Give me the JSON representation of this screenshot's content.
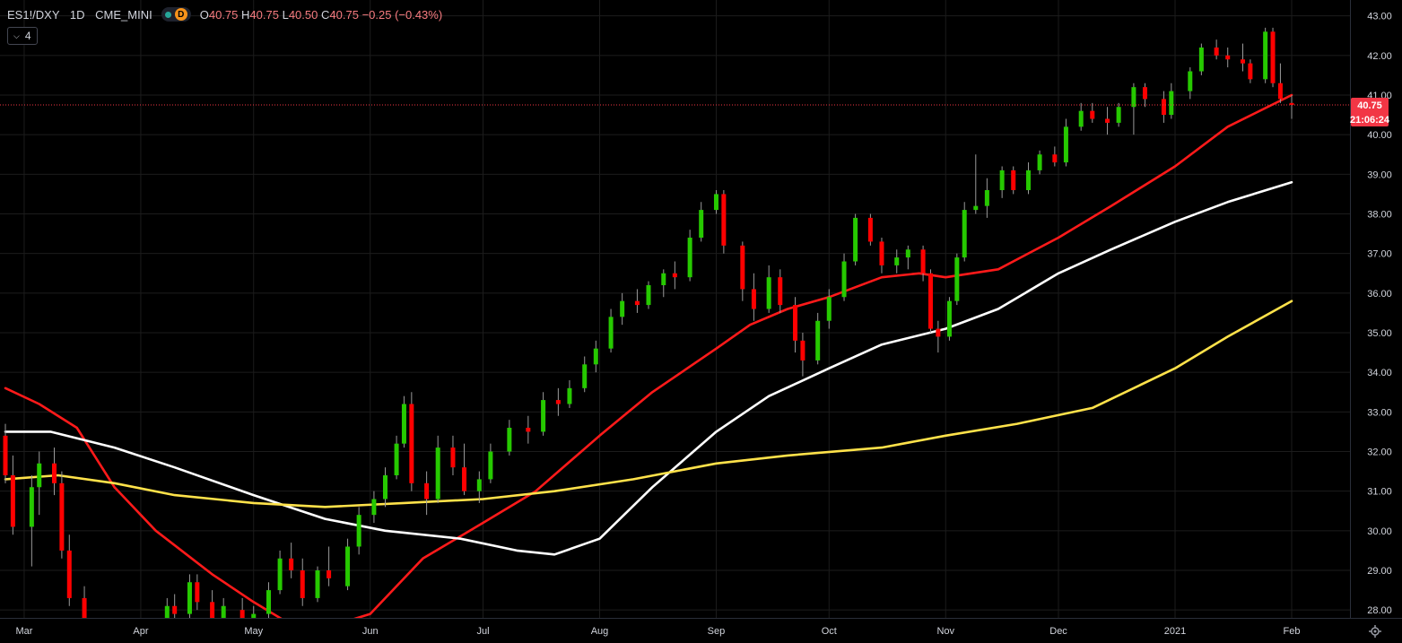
{
  "legend": {
    "symbol": "ES1!/DXY",
    "interval": "1D",
    "exchange": "CME_MINI",
    "status_letter": "D",
    "o_label": "O",
    "o_value": "40.75",
    "h_label": "H",
    "h_value": "40.75",
    "l_label": "L",
    "l_value": "40.50",
    "c_label": "C",
    "c_value": "40.75",
    "change": "−0.25 (−0.43%)",
    "indicators_count": "4"
  },
  "price_tag": {
    "value": "40.75",
    "countdown": "21:06:24"
  },
  "colors": {
    "up": "#26c900",
    "down": "#ff0000",
    "neutral": "#3fd7ea",
    "ma_red": "#ff1a1a",
    "ma_white": "#ffffff",
    "ma_yellow": "#ffe24a",
    "grid": "#1c1c1c",
    "tag": "#f23645"
  },
  "chart_data": {
    "type": "candlestick",
    "ylim": [
      27.8,
      43.4
    ],
    "y_ticks": [
      "28.00",
      "29.00",
      "30.00",
      "31.00",
      "32.00",
      "33.00",
      "34.00",
      "35.00",
      "36.00",
      "37.00",
      "38.00",
      "39.00",
      "40.00",
      "41.00",
      "42.00",
      "43.00"
    ],
    "x_labels": [
      "Mar",
      "Apr",
      "May",
      "Jun",
      "Jul",
      "Aug",
      "Sep",
      "Oct",
      "Nov",
      "Dec",
      "2021",
      "Feb"
    ],
    "x_label_dates": [
      "2020-03-01",
      "2020-04-01",
      "2020-05-01",
      "2020-06-01",
      "2020-07-01",
      "2020-08-01",
      "2020-09-01",
      "2020-10-01",
      "2020-11-01",
      "2020-12-01",
      "2021-01-01",
      "2021-02-01"
    ],
    "date_range": [
      "2020-02-25",
      "2021-02-01"
    ],
    "last_price": 40.75,
    "candles": [
      [
        "2020-02-25",
        32.4,
        32.7,
        31.2,
        31.4
      ],
      [
        "2020-02-27",
        31.4,
        31.9,
        29.9,
        30.1
      ],
      [
        "2020-03-03",
        30.1,
        31.4,
        29.1,
        31.1
      ],
      [
        "2020-03-05",
        31.1,
        32.0,
        30.4,
        31.7
      ],
      [
        "2020-03-09",
        31.7,
        32.1,
        30.9,
        31.2
      ],
      [
        "2020-03-11",
        31.2,
        31.5,
        29.3,
        29.5
      ],
      [
        "2020-03-13",
        29.5,
        29.9,
        28.1,
        28.3
      ],
      [
        "2020-03-17",
        28.3,
        28.6,
        27.3,
        27.5
      ],
      [
        "2020-04-08",
        27.6,
        28.3,
        27.5,
        28.1
      ],
      [
        "2020-04-10",
        28.1,
        28.4,
        27.7,
        27.9
      ],
      [
        "2020-04-14",
        27.9,
        28.9,
        27.8,
        28.7
      ],
      [
        "2020-04-16",
        28.7,
        28.9,
        28.0,
        28.2
      ],
      [
        "2020-04-20",
        28.2,
        28.5,
        27.6,
        27.8
      ],
      [
        "2020-04-23",
        27.8,
        28.3,
        27.5,
        28.1
      ],
      [
        "2020-04-28",
        28.0,
        28.3,
        27.4,
        27.6
      ],
      [
        "2020-05-01",
        27.6,
        28.1,
        27.4,
        27.9
      ],
      [
        "2020-05-05",
        27.9,
        28.7,
        27.8,
        28.5
      ],
      [
        "2020-05-08",
        28.5,
        29.5,
        28.4,
        29.3
      ],
      [
        "2020-05-11",
        29.3,
        29.7,
        28.8,
        29.0
      ],
      [
        "2020-05-14",
        29.0,
        29.3,
        28.1,
        28.3
      ],
      [
        "2020-05-18",
        28.3,
        29.1,
        28.2,
        29.0
      ],
      [
        "2020-05-21",
        29.0,
        29.6,
        28.6,
        28.8
      ],
      [
        "2020-05-26",
        28.6,
        29.8,
        28.5,
        29.6
      ],
      [
        "2020-05-29",
        29.6,
        30.6,
        29.4,
        30.4
      ],
      [
        "2020-06-02",
        30.4,
        31.0,
        30.2,
        30.8
      ],
      [
        "2020-06-05",
        30.8,
        31.6,
        30.6,
        31.4
      ],
      [
        "2020-06-08",
        31.4,
        32.4,
        31.3,
        32.2
      ],
      [
        "2020-06-10",
        32.2,
        33.4,
        32.1,
        33.2
      ],
      [
        "2020-06-12",
        33.2,
        33.5,
        31.0,
        31.2
      ],
      [
        "2020-06-16",
        31.2,
        31.5,
        30.4,
        30.8
      ],
      [
        "2020-06-19",
        30.8,
        32.4,
        30.7,
        32.1
      ],
      [
        "2020-06-23",
        32.1,
        32.4,
        31.4,
        31.6
      ],
      [
        "2020-06-26",
        31.6,
        32.2,
        30.9,
        31.0
      ],
      [
        "2020-06-30",
        31.0,
        31.5,
        30.7,
        31.3
      ],
      [
        "2020-07-03",
        31.3,
        32.2,
        31.2,
        32.0
      ],
      [
        "2020-07-08",
        32.0,
        32.8,
        31.9,
        32.6
      ],
      [
        "2020-07-13",
        32.6,
        32.9,
        32.2,
        32.5
      ],
      [
        "2020-07-17",
        32.5,
        33.5,
        32.4,
        33.3
      ],
      [
        "2020-07-21",
        33.3,
        33.6,
        32.9,
        33.2
      ],
      [
        "2020-07-24",
        33.2,
        33.8,
        33.1,
        33.6
      ],
      [
        "2020-07-28",
        33.6,
        34.4,
        33.5,
        34.2
      ],
      [
        "2020-07-31",
        34.2,
        34.8,
        34.0,
        34.6
      ],
      [
        "2020-08-04",
        34.6,
        35.6,
        34.5,
        35.4
      ],
      [
        "2020-08-07",
        35.4,
        36.0,
        35.2,
        35.8
      ],
      [
        "2020-08-11",
        35.8,
        36.1,
        35.5,
        35.7
      ],
      [
        "2020-08-14",
        35.7,
        36.3,
        35.6,
        36.2
      ],
      [
        "2020-08-18",
        36.2,
        36.6,
        35.9,
        36.5
      ],
      [
        "2020-08-21",
        36.5,
        36.8,
        36.1,
        36.4
      ],
      [
        "2020-08-25",
        36.4,
        37.6,
        36.3,
        37.4
      ],
      [
        "2020-08-28",
        37.4,
        38.3,
        37.3,
        38.1
      ],
      [
        "2020-09-01",
        38.1,
        38.6,
        38.0,
        38.5
      ],
      [
        "2020-09-03",
        38.5,
        38.6,
        37.0,
        37.2
      ],
      [
        "2020-09-08",
        37.2,
        37.3,
        35.8,
        36.1
      ],
      [
        "2020-09-11",
        36.1,
        36.5,
        35.3,
        35.6
      ],
      [
        "2020-09-15",
        35.6,
        36.7,
        35.5,
        36.4
      ],
      [
        "2020-09-18",
        36.4,
        36.6,
        35.5,
        35.7
      ],
      [
        "2020-09-22",
        35.7,
        35.9,
        34.5,
        34.8
      ],
      [
        "2020-09-24",
        34.8,
        35.0,
        33.9,
        34.3
      ],
      [
        "2020-09-28",
        34.3,
        35.5,
        34.2,
        35.3
      ],
      [
        "2020-10-01",
        35.3,
        36.1,
        35.1,
        35.9
      ],
      [
        "2020-10-05",
        35.9,
        37.0,
        35.8,
        36.8
      ],
      [
        "2020-10-08",
        36.8,
        38.0,
        36.7,
        37.9
      ],
      [
        "2020-10-12",
        37.9,
        38.0,
        37.2,
        37.3
      ],
      [
        "2020-10-15",
        37.3,
        37.4,
        36.5,
        36.7
      ],
      [
        "2020-10-19",
        36.7,
        37.1,
        36.5,
        36.9
      ],
      [
        "2020-10-22",
        36.9,
        37.2,
        36.6,
        37.1
      ],
      [
        "2020-10-26",
        37.1,
        37.2,
        36.3,
        36.5
      ],
      [
        "2020-10-28",
        36.5,
        36.6,
        35.0,
        35.1
      ],
      [
        "2020-10-30",
        35.1,
        35.3,
        34.5,
        34.9
      ],
      [
        "2020-11-02",
        34.9,
        35.9,
        34.8,
        35.8
      ],
      [
        "2020-11-04",
        35.8,
        37.0,
        35.7,
        36.9
      ],
      [
        "2020-11-06",
        36.9,
        38.3,
        36.8,
        38.1
      ],
      [
        "2020-11-09",
        38.1,
        39.5,
        38.0,
        38.2
      ],
      [
        "2020-11-12",
        38.2,
        38.9,
        37.9,
        38.6
      ],
      [
        "2020-11-16",
        38.6,
        39.2,
        38.4,
        39.1
      ],
      [
        "2020-11-19",
        39.1,
        39.2,
        38.5,
        38.6
      ],
      [
        "2020-11-23",
        38.6,
        39.3,
        38.5,
        39.1
      ],
      [
        "2020-11-26",
        39.1,
        39.6,
        39.0,
        39.5
      ],
      [
        "2020-11-30",
        39.5,
        39.7,
        39.2,
        39.3
      ],
      [
        "2020-12-03",
        39.3,
        40.4,
        39.2,
        40.2
      ],
      [
        "2020-12-07",
        40.2,
        40.8,
        40.1,
        40.6
      ],
      [
        "2020-12-10",
        40.6,
        40.8,
        40.3,
        40.4
      ],
      [
        "2020-12-14",
        40.4,
        40.7,
        40.0,
        40.3
      ],
      [
        "2020-12-17",
        40.3,
        40.8,
        40.2,
        40.7
      ],
      [
        "2020-12-21",
        40.7,
        41.3,
        40.0,
        41.2
      ],
      [
        "2020-12-24",
        41.2,
        41.3,
        40.7,
        40.9
      ],
      [
        "2020-12-29",
        40.9,
        41.1,
        40.3,
        40.5
      ],
      [
        "2020-12-31",
        40.5,
        41.3,
        40.4,
        41.1
      ],
      [
        "2021-01-05",
        41.1,
        41.7,
        40.9,
        41.6
      ],
      [
        "2021-01-08",
        41.6,
        42.3,
        41.5,
        42.2
      ],
      [
        "2021-01-12",
        42.2,
        42.4,
        41.9,
        42.0
      ],
      [
        "2021-01-15",
        42.0,
        42.2,
        41.7,
        41.9
      ],
      [
        "2021-01-19",
        41.9,
        42.3,
        41.6,
        41.8
      ],
      [
        "2021-01-21",
        41.8,
        41.9,
        41.3,
        41.4
      ],
      [
        "2021-01-25",
        41.4,
        42.7,
        41.3,
        42.6
      ],
      [
        "2021-01-27",
        42.6,
        42.7,
        41.2,
        41.3
      ],
      [
        "2021-01-29",
        41.3,
        41.8,
        40.8,
        40.9
      ],
      [
        "2021-02-01",
        40.8,
        41.0,
        40.4,
        40.75
      ]
    ],
    "series": [
      {
        "color_key": "ma_red",
        "points": [
          [
            "2020-02-25",
            33.6
          ],
          [
            "2020-03-05",
            33.2
          ],
          [
            "2020-03-15",
            32.6
          ],
          [
            "2020-03-25",
            31.1
          ],
          [
            "2020-04-05",
            30.0
          ],
          [
            "2020-04-20",
            28.9
          ],
          [
            "2020-05-01",
            28.2
          ],
          [
            "2020-05-15",
            27.4
          ],
          [
            "2020-06-01",
            27.9
          ],
          [
            "2020-06-15",
            29.3
          ],
          [
            "2020-07-01",
            30.2
          ],
          [
            "2020-07-15",
            31.0
          ],
          [
            "2020-08-01",
            32.4
          ],
          [
            "2020-08-15",
            33.5
          ],
          [
            "2020-09-01",
            34.6
          ],
          [
            "2020-09-10",
            35.2
          ],
          [
            "2020-09-20",
            35.6
          ],
          [
            "2020-10-01",
            35.9
          ],
          [
            "2020-10-15",
            36.4
          ],
          [
            "2020-10-25",
            36.5
          ],
          [
            "2020-11-01",
            36.4
          ],
          [
            "2020-11-15",
            36.6
          ],
          [
            "2020-12-01",
            37.4
          ],
          [
            "2020-12-15",
            38.2
          ],
          [
            "2021-01-01",
            39.2
          ],
          [
            "2021-01-15",
            40.2
          ],
          [
            "2021-02-01",
            41.0
          ]
        ]
      },
      {
        "color_key": "ma_white",
        "points": [
          [
            "2020-02-25",
            32.5
          ],
          [
            "2020-03-08",
            32.5
          ],
          [
            "2020-03-25",
            32.1
          ],
          [
            "2020-04-10",
            31.6
          ],
          [
            "2020-05-01",
            30.9
          ],
          [
            "2020-05-20",
            30.3
          ],
          [
            "2020-06-05",
            30.0
          ],
          [
            "2020-06-25",
            29.8
          ],
          [
            "2020-07-10",
            29.5
          ],
          [
            "2020-07-20",
            29.4
          ],
          [
            "2020-08-01",
            29.8
          ],
          [
            "2020-08-15",
            31.1
          ],
          [
            "2020-09-01",
            32.5
          ],
          [
            "2020-09-15",
            33.4
          ],
          [
            "2020-10-01",
            34.1
          ],
          [
            "2020-10-15",
            34.7
          ],
          [
            "2020-11-01",
            35.1
          ],
          [
            "2020-11-15",
            35.6
          ],
          [
            "2020-12-01",
            36.5
          ],
          [
            "2020-12-15",
            37.1
          ],
          [
            "2021-01-01",
            37.8
          ],
          [
            "2021-01-15",
            38.3
          ],
          [
            "2021-02-01",
            38.8
          ]
        ]
      },
      {
        "color_key": "ma_yellow",
        "points": [
          [
            "2020-02-25",
            31.3
          ],
          [
            "2020-03-10",
            31.4
          ],
          [
            "2020-03-25",
            31.2
          ],
          [
            "2020-04-10",
            30.9
          ],
          [
            "2020-05-01",
            30.7
          ],
          [
            "2020-05-20",
            30.6
          ],
          [
            "2020-06-10",
            30.7
          ],
          [
            "2020-07-01",
            30.8
          ],
          [
            "2020-07-20",
            31.0
          ],
          [
            "2020-08-10",
            31.3
          ],
          [
            "2020-09-01",
            31.7
          ],
          [
            "2020-09-20",
            31.9
          ],
          [
            "2020-10-15",
            32.1
          ],
          [
            "2020-11-01",
            32.4
          ],
          [
            "2020-11-20",
            32.7
          ],
          [
            "2020-12-10",
            33.1
          ],
          [
            "2021-01-01",
            34.1
          ],
          [
            "2021-01-15",
            34.9
          ],
          [
            "2021-02-01",
            35.8
          ]
        ]
      }
    ]
  }
}
